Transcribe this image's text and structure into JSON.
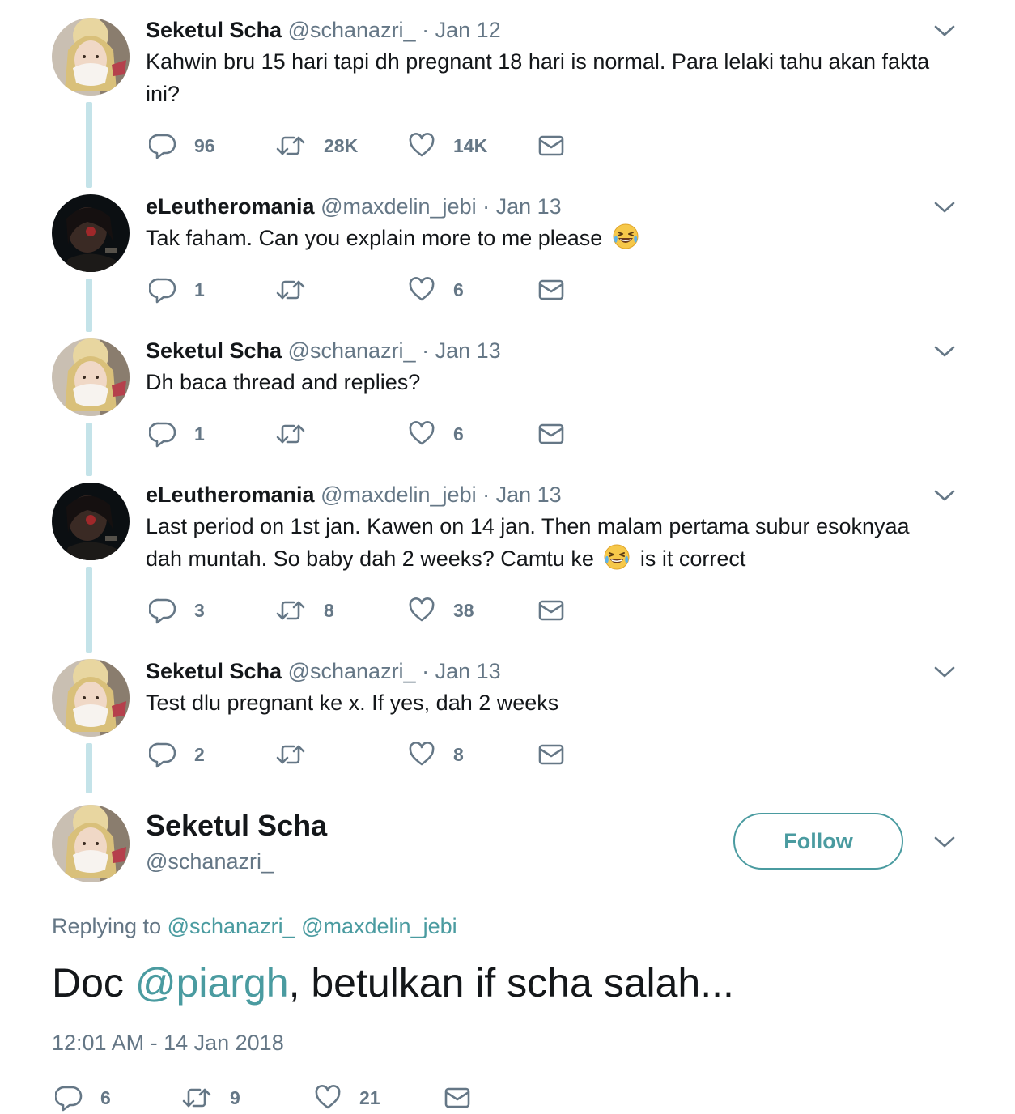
{
  "thread": [
    {
      "user": "Seketul Scha",
      "handle": "@schanazri_",
      "sep": "·",
      "date": "Jan 12",
      "text": "Kahwin bru 15 hari tapi dh pregnant 18 hari is normal. Para lelaki tahu akan fakta ini?",
      "replies": "96",
      "retweets": "28K",
      "likes": "14K"
    },
    {
      "user": "eLeutheromania",
      "handle": "@maxdelin_jebi",
      "sep": "·",
      "date": "Jan 13",
      "text": "Tak faham. Can you explain more to me please",
      "replies": "1",
      "retweets": "",
      "likes": "6"
    },
    {
      "user": "Seketul Scha",
      "handle": "@schanazri_",
      "sep": "·",
      "date": "Jan 13",
      "text": "Dh baca thread and replies?",
      "replies": "1",
      "retweets": "",
      "likes": "6"
    },
    {
      "user": "eLeutheromania",
      "handle": "@maxdelin_jebi",
      "sep": "·",
      "date": "Jan 13",
      "text_a": "Last period on 1st jan. Kawen on 14 jan. Then malam pertama subur esoknyaa dah muntah. So baby dah 2 weeks? Camtu ke",
      "text_b": "is it correct",
      "replies": "3",
      "retweets": "8",
      "likes": "38"
    },
    {
      "user": "Seketul Scha",
      "handle": "@schanazri_",
      "sep": "·",
      "date": "Jan 13",
      "text": "Test dlu pregnant ke x. If yes, dah 2 weeks",
      "replies": "2",
      "retweets": "",
      "likes": "8"
    }
  ],
  "main": {
    "user": "Seketul Scha",
    "handle": "@schanazri_",
    "follow_label": "Follow",
    "replying_prefix": "Replying to",
    "replying_to_1": "@schanazri_",
    "replying_to_2": "@maxdelin_jebi",
    "text_prefix": "Doc",
    "text_mention": "@piargh",
    "text_suffix": ", betulkan if scha salah...",
    "timestamp": "12:01 AM - 14 Jan 2018",
    "replies": "6",
    "retweets": "9",
    "likes": "21"
  },
  "icons": {
    "reply": "reply-icon",
    "retweet": "retweet-icon",
    "like": "heart-icon",
    "dm": "envelope-icon",
    "caret": "chevron-down-icon",
    "emoji": "face-with-tears-of-joy-emoji"
  },
  "colors": {
    "accent": "#4a9ba0",
    "muted": "#657786",
    "thread_line": "#c4e3e9",
    "text": "#14171a"
  }
}
